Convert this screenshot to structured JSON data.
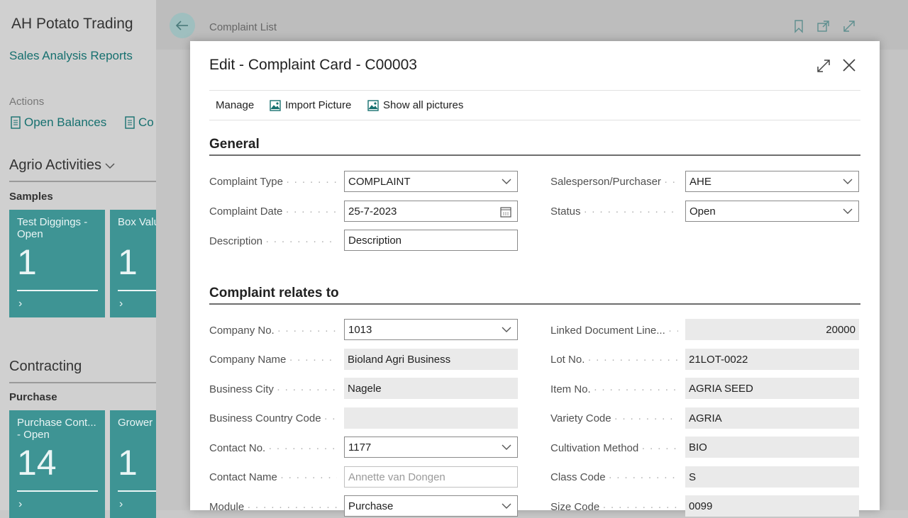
{
  "app": {
    "company": "AH Potato Trading",
    "sales_link": "Sales Analysis Reports",
    "actions_label": "Actions",
    "actions": [
      "Open Balances",
      "Co"
    ],
    "agrio_title": "Agrio Activities",
    "samples_label": "Samples",
    "sample_tiles": [
      {
        "title": "Test Diggings - Open",
        "count": "1"
      },
      {
        "title": "Box Valu Open",
        "count": "1"
      }
    ],
    "contracting_title": "Contracting",
    "purchase_label": "Purchase",
    "purchase_tiles": [
      {
        "title": "Purchase Cont... - Open",
        "count": "14"
      },
      {
        "title": "Grower - Open",
        "count": "1"
      }
    ],
    "breadcrumb": "Complaint List"
  },
  "modal": {
    "title": "Edit - Complaint Card - C00003",
    "menu": {
      "manage": "Manage",
      "import_picture": "Import Picture",
      "show_all": "Show all pictures"
    },
    "general": {
      "title": "General",
      "complaint_type": {
        "label": "Complaint Type",
        "value": "COMPLAINT"
      },
      "complaint_date": {
        "label": "Complaint Date",
        "value": "25-7-2023"
      },
      "description": {
        "label": "Description",
        "value": "Description"
      },
      "salesperson": {
        "label": "Salesperson/Purchaser",
        "value": "AHE"
      },
      "status": {
        "label": "Status",
        "value": "Open"
      }
    },
    "relates": {
      "title": "Complaint relates to",
      "company_no": {
        "label": "Company No.",
        "value": "1013"
      },
      "company_name": {
        "label": "Company Name",
        "value": "Bioland Agri Business"
      },
      "business_city": {
        "label": "Business City",
        "value": "Nagele"
      },
      "country_code": {
        "label": "Business Country Code",
        "value": ""
      },
      "contact_no": {
        "label": "Contact No.",
        "value": "1177"
      },
      "contact_name": {
        "label": "Contact Name",
        "value": "Annette van Dongen"
      },
      "module": {
        "label": "Module",
        "value": "Purchase"
      },
      "linked_doc": {
        "label": "Linked Document Line...",
        "value": "20000"
      },
      "lot_no": {
        "label": "Lot No.",
        "value": "21LOT-0022"
      },
      "item_no": {
        "label": "Item No.",
        "value": "AGRIA SEED"
      },
      "variety_code": {
        "label": "Variety Code",
        "value": "AGRIA"
      },
      "cultivation": {
        "label": "Cultivation Method",
        "value": "BIO"
      },
      "class_code": {
        "label": "Class Code",
        "value": "S"
      },
      "size_code": {
        "label": "Size Code",
        "value": "0099"
      }
    }
  },
  "colors": {
    "accent": "#16706f",
    "tile": "#3e9494"
  }
}
